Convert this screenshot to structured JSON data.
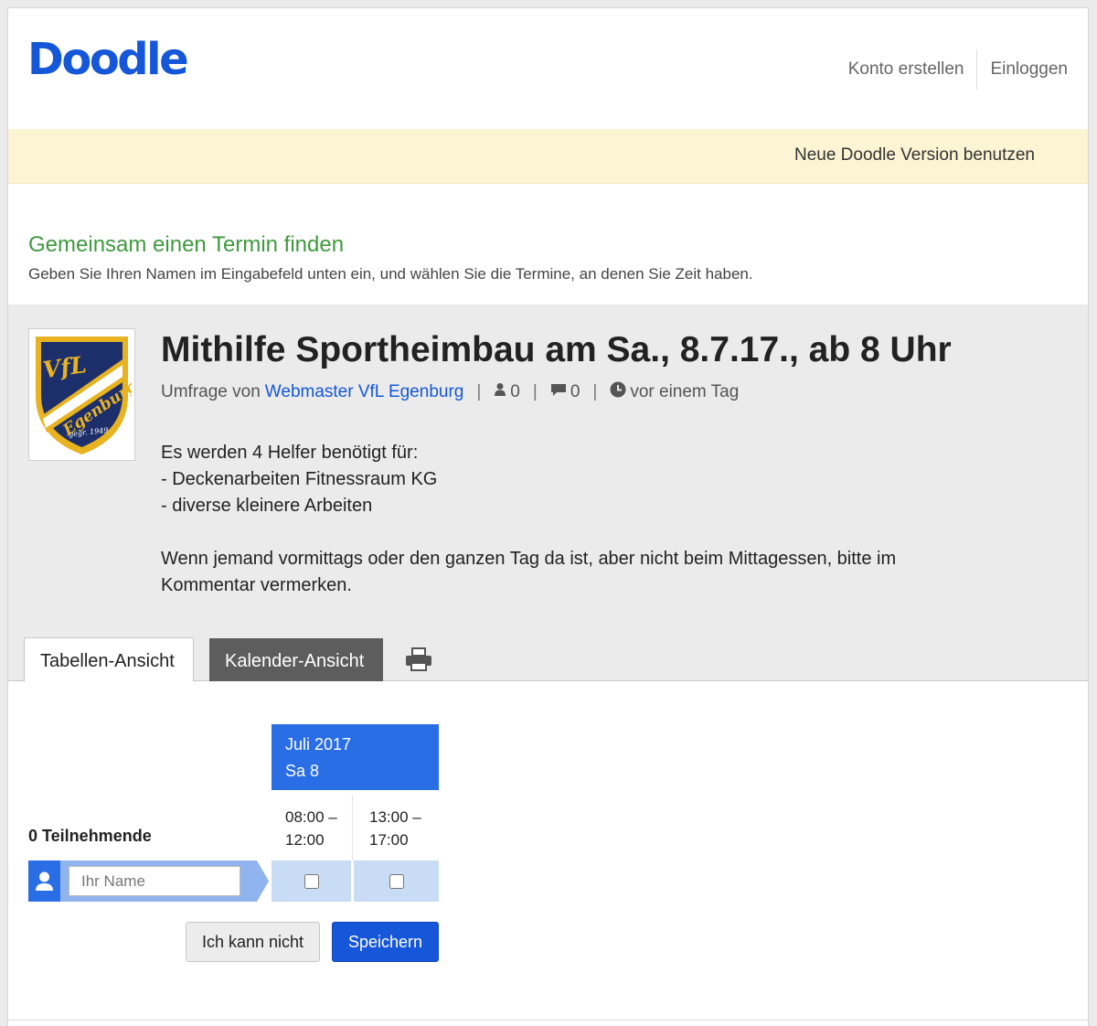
{
  "header": {
    "logo": "Doodle",
    "nav": {
      "create_account": "Konto erstellen",
      "login": "Einloggen"
    }
  },
  "banner": {
    "link": "Neue Doodle Version benutzen"
  },
  "intro": {
    "title": "Gemeinsam einen Termin finden",
    "subtitle": "Geben Sie Ihren Namen im Eingabefeld unten ein, und wählen Sie die Termine, an denen Sie Zeit haben."
  },
  "poll": {
    "logo": {
      "text_top": "VfL",
      "text_band": "Egenburg",
      "text_bottom": "gegr. 1949",
      "colors": {
        "navy": "#1d2f6b",
        "gold": "#e7b321"
      }
    },
    "title": "Mithilfe Sportheimbau am Sa., 8.7.17., ab 8 Uhr",
    "meta": {
      "by_label": "Umfrage von",
      "author": "Webmaster VfL Egenburg",
      "participants_count": "0",
      "comments_count": "0",
      "time": "vor einem Tag",
      "separator": "|"
    },
    "description": [
      "Es werden 4 Helfer benötigt für:",
      "- Deckenarbeiten Fitnessraum KG",
      "- diverse kleinere Arbeiten",
      "",
      "Wenn jemand vormittags oder den ganzen Tag da ist, aber nicht beim Mittagessen, bitte im",
      "Kommentar vermerken."
    ]
  },
  "tabs": {
    "table": "Tabellen-Ansicht",
    "calendar": "Kalender-Ansicht",
    "print_icon": "printer-icon"
  },
  "table": {
    "month": "Juli 2017",
    "day": "Sa 8",
    "slots": [
      {
        "start": "08:00 –",
        "end": "12:00"
      },
      {
        "start": "13:00 –",
        "end": "17:00"
      }
    ],
    "participants_label": "0 Teilnehmende",
    "name_placeholder": "Ihr Name"
  },
  "buttons": {
    "cant": "Ich kann nicht",
    "save": "Speichern"
  },
  "colors": {
    "brand_blue": "#1557d8",
    "green": "#3f9a3f",
    "banner": "#fcf4d3",
    "header_blue": "#2a6ee6",
    "cell_blue": "#c9dcf6"
  }
}
